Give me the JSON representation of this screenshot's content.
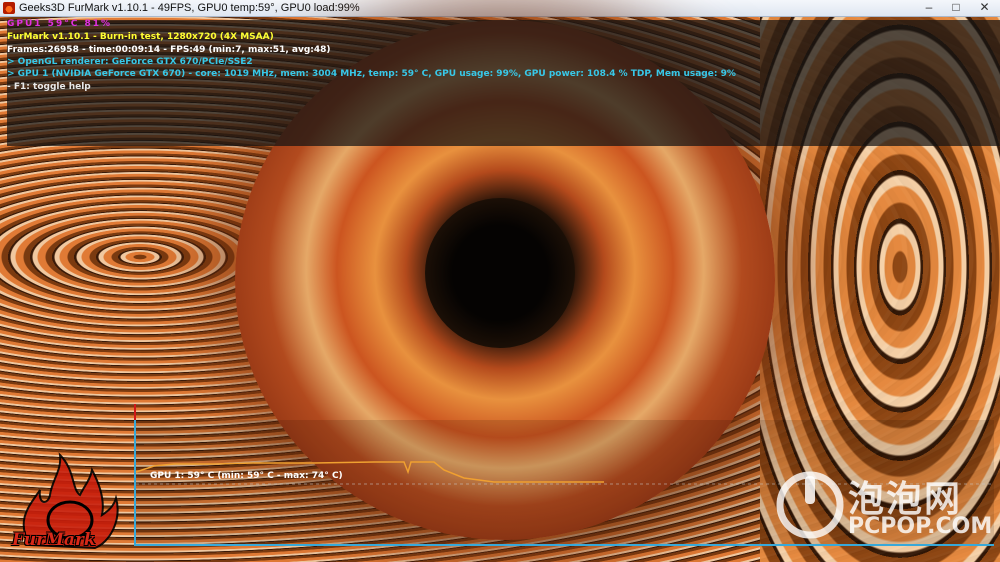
{
  "window": {
    "title": "Geeks3D FurMark v1.10.1 - 49FPS, GPU0 temp:59°, GPU0 load:99%",
    "minimize_glyph": "–",
    "maximize_glyph": "□",
    "close_glyph": "✕"
  },
  "overlay": {
    "gpu_header": "GPU1 59°C 81%",
    "title_line": "FurMark v1.10.1 - Burn-in test, 1280x720 (4X MSAA)",
    "frames_line": "Frames:26958 - time:00:09:14 - FPS:49 (min:7, max:51, avg:48)",
    "renderer_line": "> OpenGL renderer: GeForce GTX 670/PCIe/SSE2",
    "gpu_line": "> GPU 1 (NVIDIA GeForce GTX 670) - core: 1019 MHz, mem: 3004 MHz, temp: 59° C, GPU usage: 99%, GPU power: 108.4 % TDP, Mem usage: 9%",
    "help_line": "- F1: toggle help"
  },
  "graph": {
    "label": "GPU 1: 59° C (min: 59° C - max: 74° C)",
    "line_color": "#f0a030",
    "axis_color": "#38a8d8"
  },
  "logos": {
    "furmark": "FurMark",
    "watermark_cn": "泡泡网",
    "watermark_en": "PCPOP.COM"
  }
}
